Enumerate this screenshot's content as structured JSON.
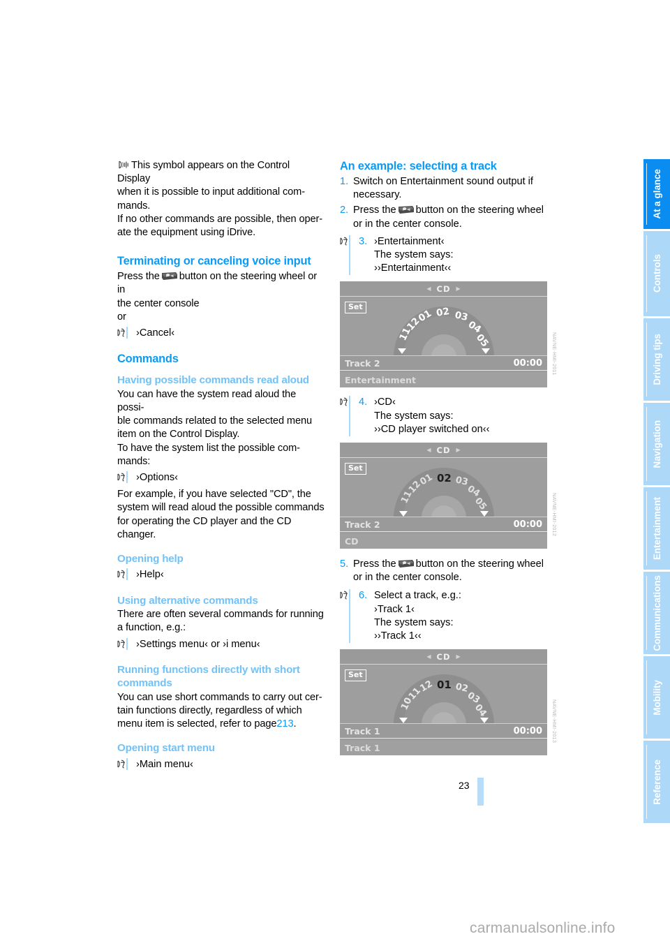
{
  "document": {
    "page_number": "23",
    "watermark": "carmanualsonline.info"
  },
  "sidebar": {
    "tabs": [
      {
        "label": "At a glance",
        "active": true
      },
      {
        "label": "Controls",
        "active": false
      },
      {
        "label": "Driving tips",
        "active": false
      },
      {
        "label": "Navigation",
        "active": false
      },
      {
        "label": "Entertainment",
        "active": false
      },
      {
        "label": "Communications",
        "active": false
      },
      {
        "label": "Mobility",
        "active": false
      },
      {
        "label": "Reference",
        "active": false
      }
    ]
  },
  "left_column": {
    "intro": {
      "line1": "This symbol appears on the Control Display",
      "line2": "when it is possible to input additional com-",
      "line3": "mands.",
      "line4": "If no other commands are possible, then oper-",
      "line5": "ate the equipment using iDrive."
    },
    "terminating": {
      "title": "Terminating or canceling voice input",
      "text_before_icon": "Press the",
      "text_after_icon": "button on the steering wheel or in",
      "line2": "the center console",
      "line3": "or",
      "command": "›Cancel‹"
    },
    "commands": {
      "title": "Commands"
    },
    "read_aloud": {
      "title": "Having possible commands read aloud",
      "line1": "You can have the system read aloud the possi-",
      "line2": "ble commands related to the selected menu",
      "line3": "item on the Control Display.",
      "line4": "To have the system list the possible com-",
      "line5": "mands:",
      "command": "›Options‹",
      "example1": "For example, if you have selected \"CD\", the",
      "example2": "system will read aloud the possible commands",
      "example3": "for operating the CD player and the CD",
      "example4": "changer."
    },
    "opening_help": {
      "title": "Opening help",
      "command": "›Help‹"
    },
    "alternative": {
      "title": "Using alternative commands",
      "line1": "There are often several commands for running",
      "line2": "a function, e.g.:",
      "command": "›Settings menu‹  or ›i menu‹"
    },
    "short_commands": {
      "title_line1": "Running functions directly with short",
      "title_line2": "commands",
      "line1": "You can use short commands to carry out cer-",
      "line2": "tain functions directly, regardless of which",
      "line3_before": "menu item is selected, refer to page",
      "page_ref": "213",
      "line3_after": "."
    },
    "start_menu": {
      "title": "Opening start menu",
      "command": "›Main menu‹"
    }
  },
  "right_column": {
    "title": "An example: selecting a track",
    "steps": [
      {
        "number": "1.",
        "line1": "Switch on Entertainment sound output if",
        "line2": "necessary.",
        "has_icon": false,
        "has_button": false
      },
      {
        "number": "2.",
        "line1_before": "Press the",
        "line1_after": "button on the steering wheel",
        "line2": "or in the center console.",
        "has_icon": false,
        "has_button": true
      },
      {
        "number": "3.",
        "line1": "›Entertainment‹",
        "line2": "The system says:",
        "line3": "››Entertainment‹‹",
        "has_icon": true,
        "has_button": false
      },
      {
        "number": "4.",
        "line1": "›CD‹",
        "line2": "The system says:",
        "line3": "››CD player switched on‹‹",
        "has_icon": true,
        "has_button": false
      },
      {
        "number": "5.",
        "line1_before": "Press the",
        "line1_after": "button on the steering wheel",
        "line2": "or in the center console.",
        "has_icon": false,
        "has_button": true
      },
      {
        "number": "6.",
        "line1": "Select a track, e.g.:",
        "line2": "›Track 1‹",
        "line3": "The system says:",
        "line4": "››Track 1‹‹",
        "has_icon": true,
        "has_button": false
      }
    ],
    "displays": [
      {
        "header": "CD",
        "set_label": "Set",
        "dial_numbers": [
          "11",
          "12",
          "01",
          "02",
          "03",
          "04",
          "05"
        ],
        "highlighted": null,
        "track_label": "Track 2",
        "time": "00:00",
        "bottom_label": "Entertainment",
        "image_id": "NAVNE-HMI-2011"
      },
      {
        "header": "CD",
        "set_label": "Set",
        "dial_numbers": [
          "11",
          "12",
          "01",
          "02",
          "03",
          "04",
          "05"
        ],
        "highlighted": "02",
        "track_label": "Track 2",
        "time": "00:00",
        "bottom_label": "CD",
        "image_id": "NAVNE-HMI-2012"
      },
      {
        "header": "CD",
        "set_label": "Set",
        "dial_numbers": [
          "10",
          "11",
          "12",
          "01",
          "02",
          "03",
          "04"
        ],
        "highlighted": "01",
        "track_label": "Track 1",
        "time": "00:00",
        "bottom_label": "Track 1",
        "image_id": "NAVNE-HMI-2013"
      }
    ]
  },
  "colors": {
    "heading_primary": "#0a9bf5",
    "heading_secondary": "#72c2f7",
    "tab_active": "#0a8cf0",
    "tab_inactive": "#aed8f7",
    "display_bg": "#9c9c9c"
  }
}
